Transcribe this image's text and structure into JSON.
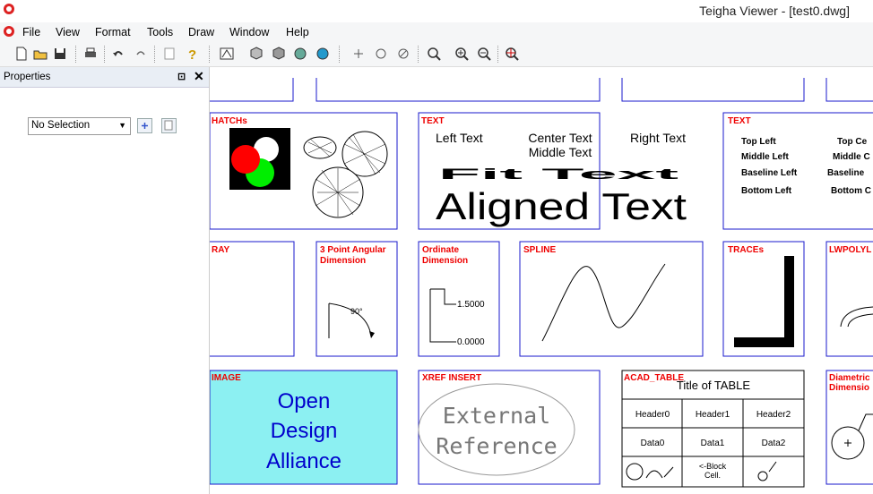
{
  "window": {
    "title": "Teigha Viewer - [test0.dwg]"
  },
  "menu": [
    "File",
    "View",
    "Format",
    "Tools",
    "Draw",
    "Window",
    "Help"
  ],
  "toolbar": {
    "icons": [
      "new-icon",
      "open-icon",
      "save-icon",
      "print-icon",
      "undo-icon",
      "redo-icon",
      "paste-icon",
      "help-icon",
      "view-icon",
      "cube-icon",
      "cube2-icon",
      "sphere-icon",
      "render-icon",
      "pan-icon",
      "orbit-icon",
      "orbit2-icon",
      "zoom-window-icon",
      "zoom-in-icon",
      "zoom-out-icon",
      "zoom-extents-icon"
    ]
  },
  "properties": {
    "title": "Properties",
    "pin": "⊡",
    "close": "✕",
    "selection": "No Selection"
  },
  "drawing": {
    "hatch": {
      "label": "HATCHs"
    },
    "text1": {
      "label": "TEXT",
      "left": "Left Text",
      "center": "Center Text",
      "right": "Right Text",
      "middle": "Middle Text",
      "fit": "Fit Text",
      "aligned": "Aligned Text"
    },
    "text2": {
      "label": "TEXT",
      "items": [
        "Top Left",
        "Top Ce",
        "Middle Left",
        "Middle C",
        "Baseline Left",
        "Baseline",
        "Bottom Left",
        "Bottom C"
      ]
    },
    "ray": {
      "label": "RAY"
    },
    "angular": {
      "label1": "3 Point Angular",
      "label2": "Dimension",
      "value": "90°"
    },
    "ordinate": {
      "label1": "Ordinate",
      "label2": "Dimension",
      "v1": "1.5000",
      "v2": "0.0000"
    },
    "spline": {
      "label": "SPLINE"
    },
    "traces": {
      "label": "TRACEs"
    },
    "lwpoly": {
      "label": "LWPOLYL"
    },
    "image": {
      "label": "IMAGE",
      "lines": [
        "Open",
        "Design",
        "Alliance"
      ]
    },
    "xref": {
      "label": "XREF INSERT",
      "lines": [
        "External",
        "Reference"
      ]
    },
    "table": {
      "label": "ACAD_TABLE",
      "title": "Title of TABLE",
      "headers": [
        "Header0",
        "Header1",
        "Header2"
      ],
      "row": [
        "Data0",
        "Data1",
        "Data2"
      ],
      "block1": "<-Block",
      "block2": "Cell."
    },
    "diam": {
      "label1": "Diametric",
      "label2": "Dimensio"
    }
  },
  "colors": {
    "frame": "#1a1acc",
    "label": "#e00000",
    "image_bg": "#8cf0f2",
    "image_text": "#0000cc"
  }
}
